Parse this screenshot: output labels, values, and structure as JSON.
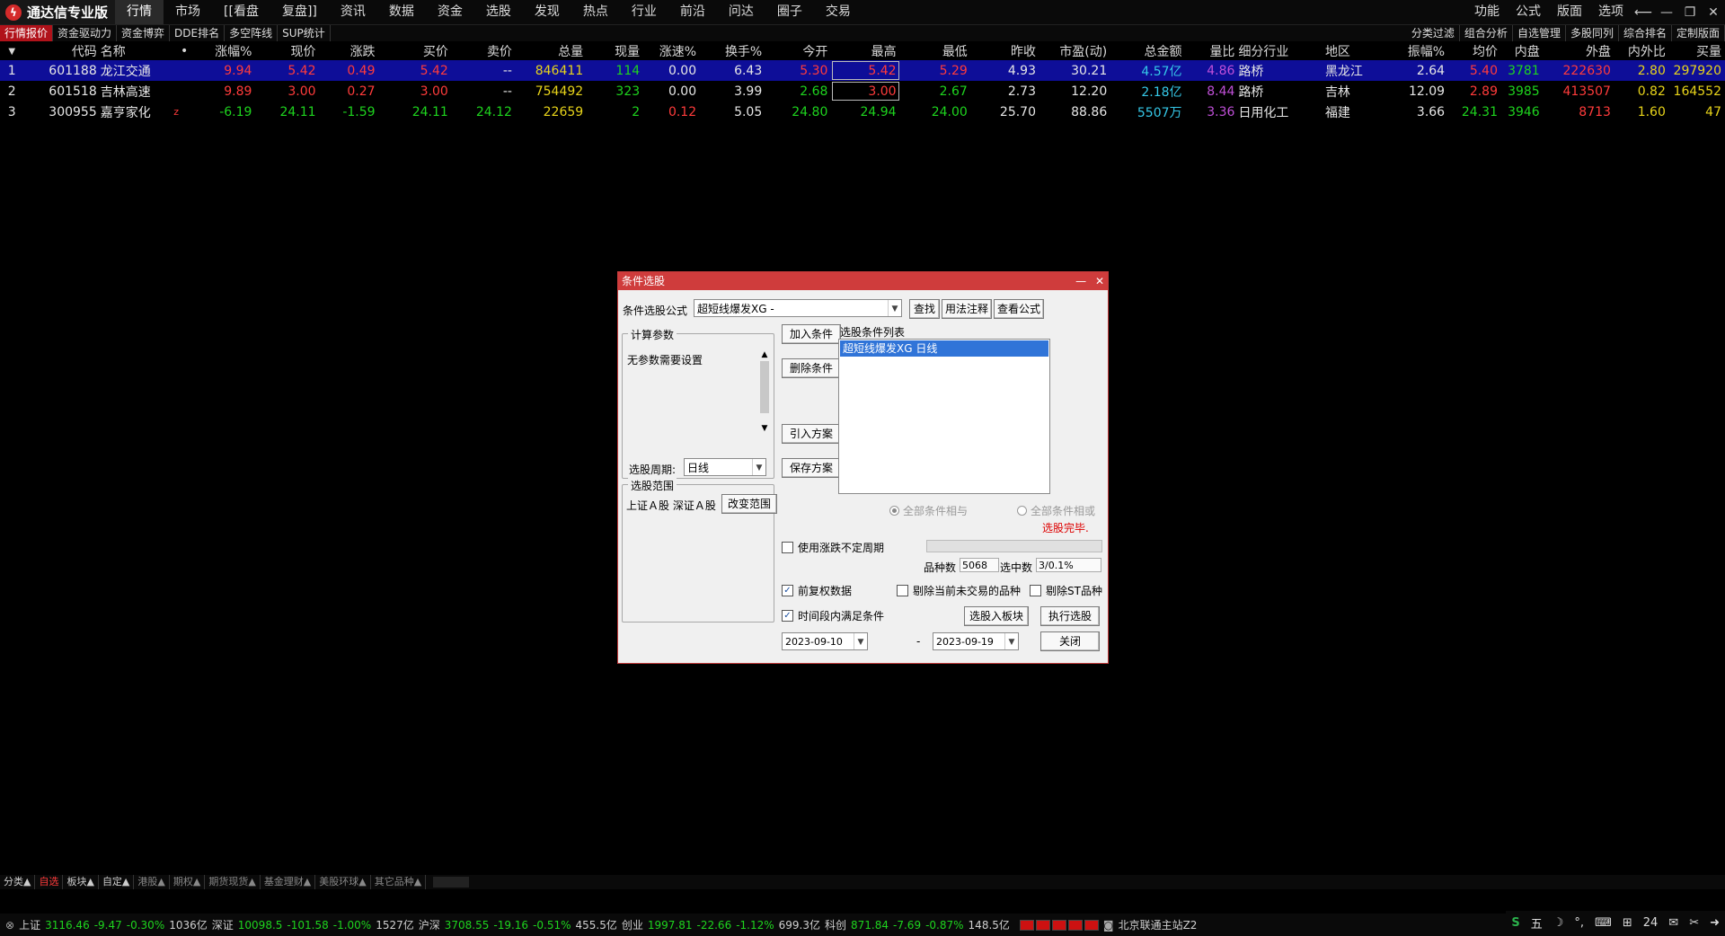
{
  "app": {
    "title": "通达信专业版"
  },
  "menu": [
    "行情",
    "市场",
    "[[看盘",
    "复盘]]",
    "资讯",
    "数据",
    "资金",
    "选股",
    "发现",
    "热点",
    "行业",
    "前沿",
    "问达",
    "圈子",
    "交易"
  ],
  "menu_right": [
    "功能",
    "公式",
    "版面",
    "选项"
  ],
  "subtabs": [
    "行情报价",
    "资金驱动力",
    "资金博弈",
    "DDE排名",
    "多空阵线",
    "SUP统计"
  ],
  "subtabs_right": [
    "分类过滤",
    "组合分析",
    "自选管理",
    "多股同列",
    "综合排名",
    "定制版面"
  ],
  "table": {
    "headers": [
      "",
      "代码",
      "名称",
      "•",
      "涨幅%",
      "现价",
      "涨跌",
      "买价",
      "卖价",
      "总量",
      "现量",
      "涨速%",
      "换手%",
      "今开",
      "最高",
      "最低",
      "昨收",
      "市盈(动)",
      "总金额",
      "量比",
      "细分行业",
      "地区",
      "振幅%",
      "均价",
      "内盘",
      "外盘",
      "内外比",
      "买量"
    ],
    "rows": [
      [
        "1",
        "601188",
        "龙江交通",
        "",
        "9.94",
        "5.42",
        "0.49",
        "5.42",
        "--",
        "846411",
        "114",
        "0.00",
        "6.43",
        "5.30",
        "5.42",
        "5.29",
        "4.93",
        "30.21",
        "4.57亿",
        "4.86",
        "路桥",
        "黑龙江",
        "2.64",
        "5.40",
        "3781",
        "222630",
        "2.80",
        "297920"
      ],
      [
        "2",
        "601518",
        "吉林高速",
        "",
        "9.89",
        "3.00",
        "0.27",
        "3.00",
        "--",
        "754492",
        "323",
        "0.00",
        "3.99",
        "2.68",
        "3.00",
        "2.67",
        "2.73",
        "12.20",
        "2.18亿",
        "8.44",
        "路桥",
        "吉林",
        "12.09",
        "2.89",
        "3985",
        "413507",
        "0.82",
        "164552"
      ],
      [
        "3",
        "300955",
        "嘉亨家化",
        "z",
        "-6.19",
        "24.11",
        "-1.59",
        "24.11",
        "24.12",
        "22659",
        "2",
        "0.12",
        "5.05",
        "24.80",
        "24.94",
        "24.00",
        "25.70",
        "88.86",
        "5507万",
        "3.36",
        "日用化工",
        "福建",
        "3.66",
        "24.31",
        "3946",
        "8713",
        "1.60",
        "47"
      ]
    ]
  },
  "dialog": {
    "title": "条件选股",
    "formula_label": "条件选股公式",
    "formula_value": "超短线爆发XG -",
    "find_btn": "查找",
    "usage_btn": "用法注释",
    "view_btn": "查看公式",
    "params_title": "计算参数",
    "params_text": "无参数需要设置",
    "period_label": "选股周期:",
    "period_value": "日线",
    "scope_title": "选股范围",
    "scope_text": "上证Ａ股 深证Ａ股",
    "change_scope_btn": "改变范围",
    "add_btn": "加入条件",
    "del_btn": "删除条件",
    "import_btn": "引入方案",
    "save_btn": "保存方案",
    "cond_list_label": "选股条件列表",
    "cond_items": [
      "超短线爆发XG  日线"
    ],
    "radio_and": "全部条件相与",
    "radio_or": "全部条件相或",
    "status": "选股完毕.",
    "use_variable_period": "使用涨跌不定周期",
    "count_label": "品种数",
    "count_value": "5068",
    "selected_label": "选中数",
    "selected_value": "3/0.1%",
    "chk_adjusted": "前复权数据",
    "chk_exclude_untraded": "剔除当前未交易的品种",
    "chk_exclude_st": "剔除ST品种",
    "chk_time_range": "时间段内满足条件",
    "to_block_btn": "选股入板块",
    "run_btn": "执行选股",
    "date_from": "2023-09-10",
    "date_to": "2023-09-19",
    "date_sep": "-",
    "close_btn": "关闭"
  },
  "bottom_tabs": [
    "分类▲",
    "自选",
    "板块▲",
    "自定▲",
    "港股▲",
    "期权▲",
    "期货现货▲",
    "基金理财▲",
    "美股环球▲",
    "其它品种▲"
  ],
  "status": {
    "sh_label": "上证",
    "sh_val": "3116.46",
    "sh_chg": "-9.47",
    "sh_pct": "-0.30%",
    "sh_amt": "1036亿",
    "sz_label": "深证",
    "sz_val": "10098.5",
    "sz_chg": "-101.58",
    "sz_pct": "-1.00%",
    "sz_amt": "1527亿",
    "hs_label": "沪深",
    "hs_val": "3708.55",
    "hs_chg": "-19.16",
    "hs_pct": "-0.51%",
    "hs_amt": "455.5亿",
    "cy_label": "创业",
    "cy_val": "1997.81",
    "cy_chg": "-22.66",
    "cy_pct": "-1.12%",
    "cy_amt": "699.3亿",
    "kc_label": "科创",
    "kc_val": "871.84",
    "kc_chg": "-7.69",
    "kc_pct": "-0.87%",
    "kc_amt": "148.5亿",
    "server": "北京联通主站Z2"
  },
  "ime": {
    "mode": "五",
    "num": "24"
  }
}
